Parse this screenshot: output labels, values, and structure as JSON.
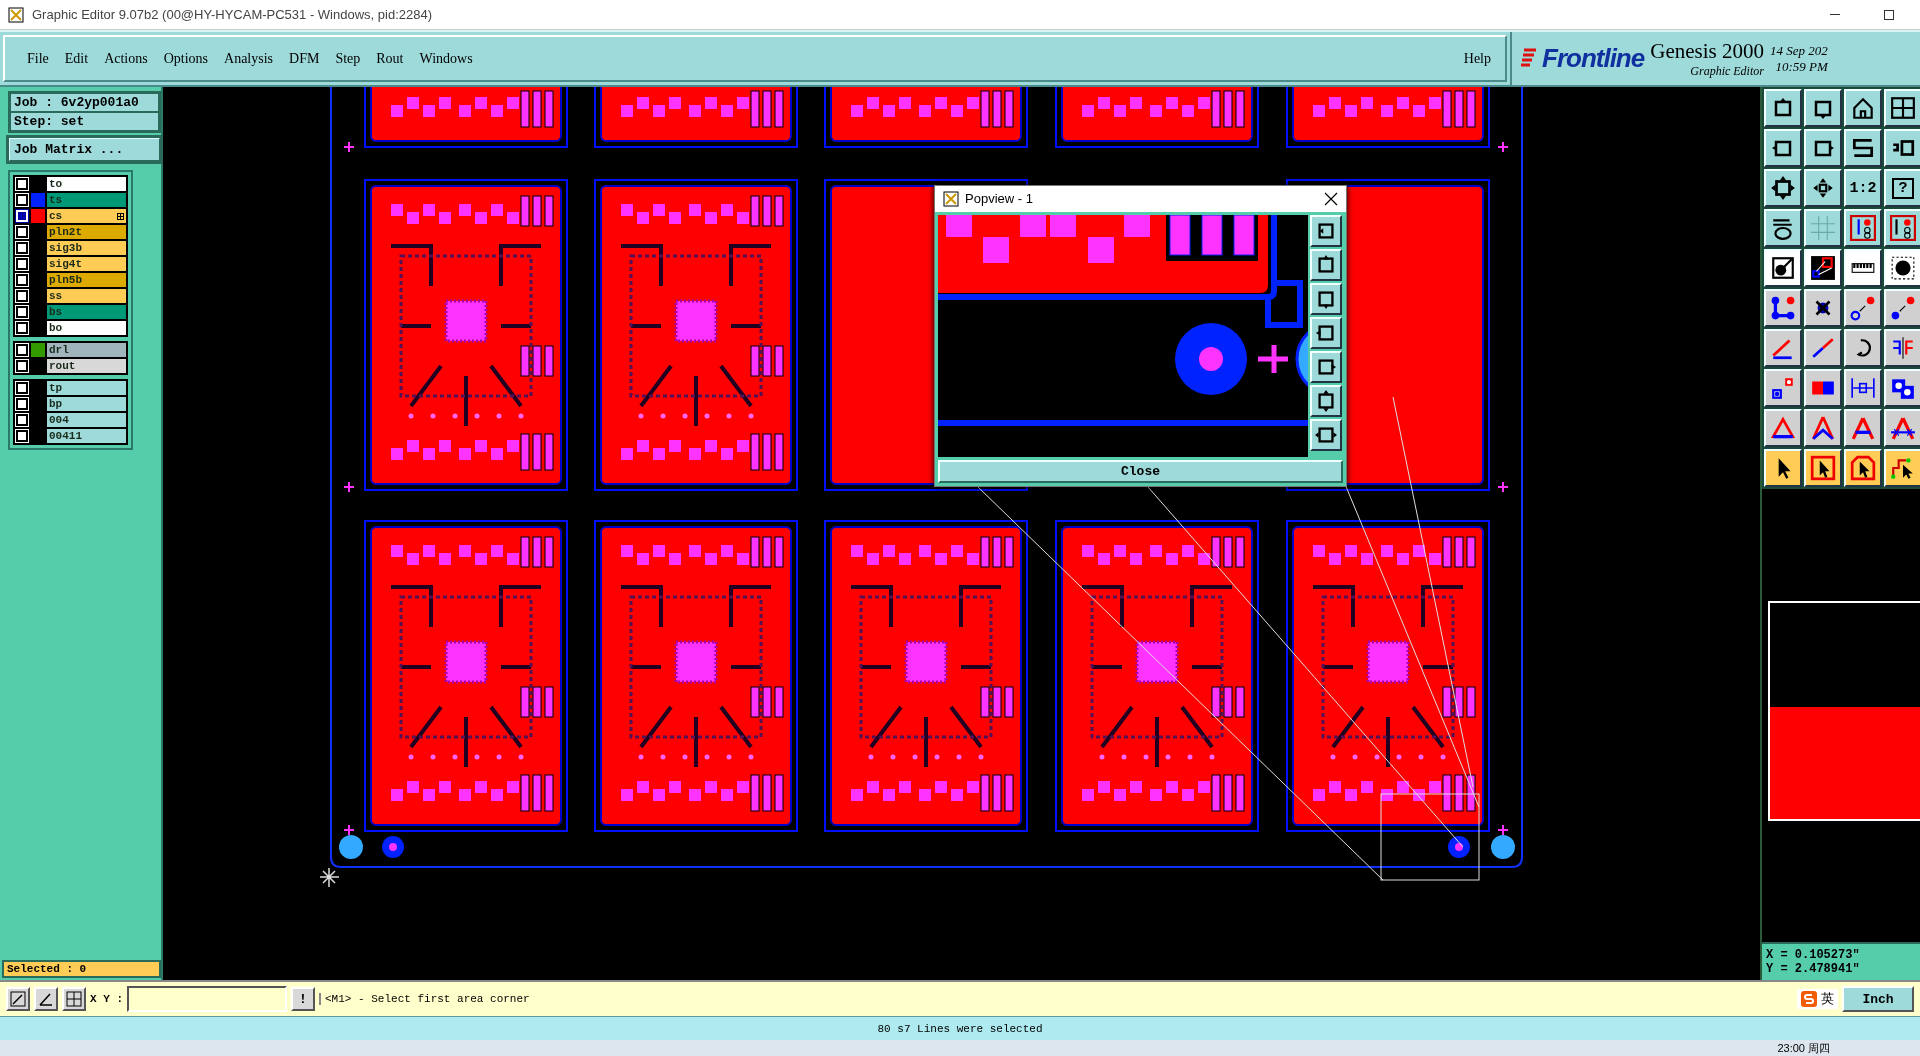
{
  "window": {
    "title": "Graphic Editor 9.07b2 (00@HY-HYCAM-PC531 - Windows, pid:2284)"
  },
  "menu": [
    "File",
    "Edit",
    "Actions",
    "Options",
    "Analysis",
    "DFM",
    "Step",
    "Rout",
    "Windows"
  ],
  "help": "Help",
  "brand": {
    "logo": "Frontline",
    "product": "Genesis 2000",
    "subtitle": "Graphic Editor",
    "date": "14 Sep 202",
    "time": "10:59 PM"
  },
  "job": {
    "job": "Job : 6v2yp001a0",
    "step": "Step: set",
    "matrix_button": "Job Matrix ..."
  },
  "layer_groups": [
    [
      {
        "name": "to",
        "kind": "outer",
        "selected": false,
        "work": false
      },
      {
        "name": "ts",
        "kind": "mask",
        "color": "#0022ff",
        "selected": false,
        "work": false
      },
      {
        "name": "cs",
        "kind": "signal",
        "color": "#ff0000",
        "selected": true,
        "work": true
      },
      {
        "name": "pln2t",
        "kind": "plane",
        "selected": false,
        "work": false
      },
      {
        "name": "sig3b",
        "kind": "signal",
        "selected": false,
        "work": false
      },
      {
        "name": "sig4t",
        "kind": "signal",
        "selected": false,
        "work": false
      },
      {
        "name": "pln5b",
        "kind": "plane",
        "selected": false,
        "work": false
      },
      {
        "name": "ss",
        "kind": "signal",
        "selected": false,
        "work": false
      },
      {
        "name": "bs",
        "kind": "mask",
        "selected": false,
        "work": false
      },
      {
        "name": "bo",
        "kind": "outer",
        "selected": false,
        "work": false
      }
    ],
    [
      {
        "name": "drl",
        "kind": "drill",
        "color": "#339900",
        "selected": false,
        "work": false
      },
      {
        "name": "rout",
        "kind": "rout",
        "selected": false,
        "work": false
      }
    ],
    [
      {
        "name": "tp",
        "kind": "misc",
        "selected": false,
        "work": false
      },
      {
        "name": "bp",
        "kind": "misc",
        "selected": false,
        "work": false
      },
      {
        "name": "004",
        "kind": "misc",
        "selected": false,
        "work": false
      },
      {
        "name": "00411",
        "kind": "misc",
        "selected": false,
        "work": false
      }
    ]
  ],
  "selected_count": "Selected : 0",
  "toolbar_labels": {
    "scale": "1:2",
    "help": "?"
  },
  "popview": {
    "title": "Popview - 1",
    "close": "Close"
  },
  "coords": {
    "x": "X = 0.105273\"",
    "y": "Y = 2.478941\""
  },
  "command": {
    "xy_label": "X Y :",
    "bang": "!",
    "prompt": "<M1> - Select first area corner",
    "ime": "英",
    "units": "Inch"
  },
  "status": "80 s7 Lines were selected",
  "taskbar": {
    "time": "23:00 周四"
  }
}
